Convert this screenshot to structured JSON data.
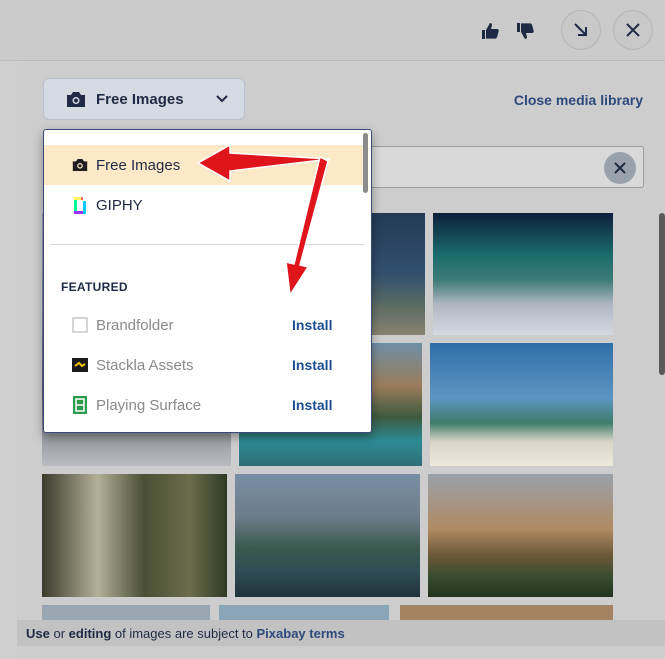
{
  "topbar": {
    "thumbs_up": "thumbs-up-icon",
    "thumbs_down": "thumbs-down-icon",
    "minimize": "arrow-down-right-icon",
    "close": "close-icon"
  },
  "source_selector": {
    "label": "Free Images",
    "icon": "camera-icon",
    "chevron": "chevron-down-icon"
  },
  "close_media_library": "Close media library",
  "dropdown": {
    "items": [
      {
        "label": "Free Images",
        "icon": "camera-icon",
        "selected": true
      },
      {
        "label": "GIPHY",
        "icon": "giphy-icon",
        "selected": false
      }
    ],
    "featured_heading": "FEATURED",
    "featured": [
      {
        "label": "Brandfolder",
        "action": "Install",
        "icon": "brandfolder-icon"
      },
      {
        "label": "Stackla Assets",
        "action": "Install",
        "icon": "stackla-icon"
      },
      {
        "label": "Playing Surface",
        "action": "Install",
        "icon": "playing-surface-icon"
      }
    ]
  },
  "footer": {
    "t1": "Use",
    "t2": " or ",
    "t3": "editing",
    "t4": " of images are subject to ",
    "link": "Pixabay terms"
  },
  "colors": {
    "highlight": "#fde9c8",
    "arrow": "#e0141b",
    "link": "#1d4f8c"
  }
}
